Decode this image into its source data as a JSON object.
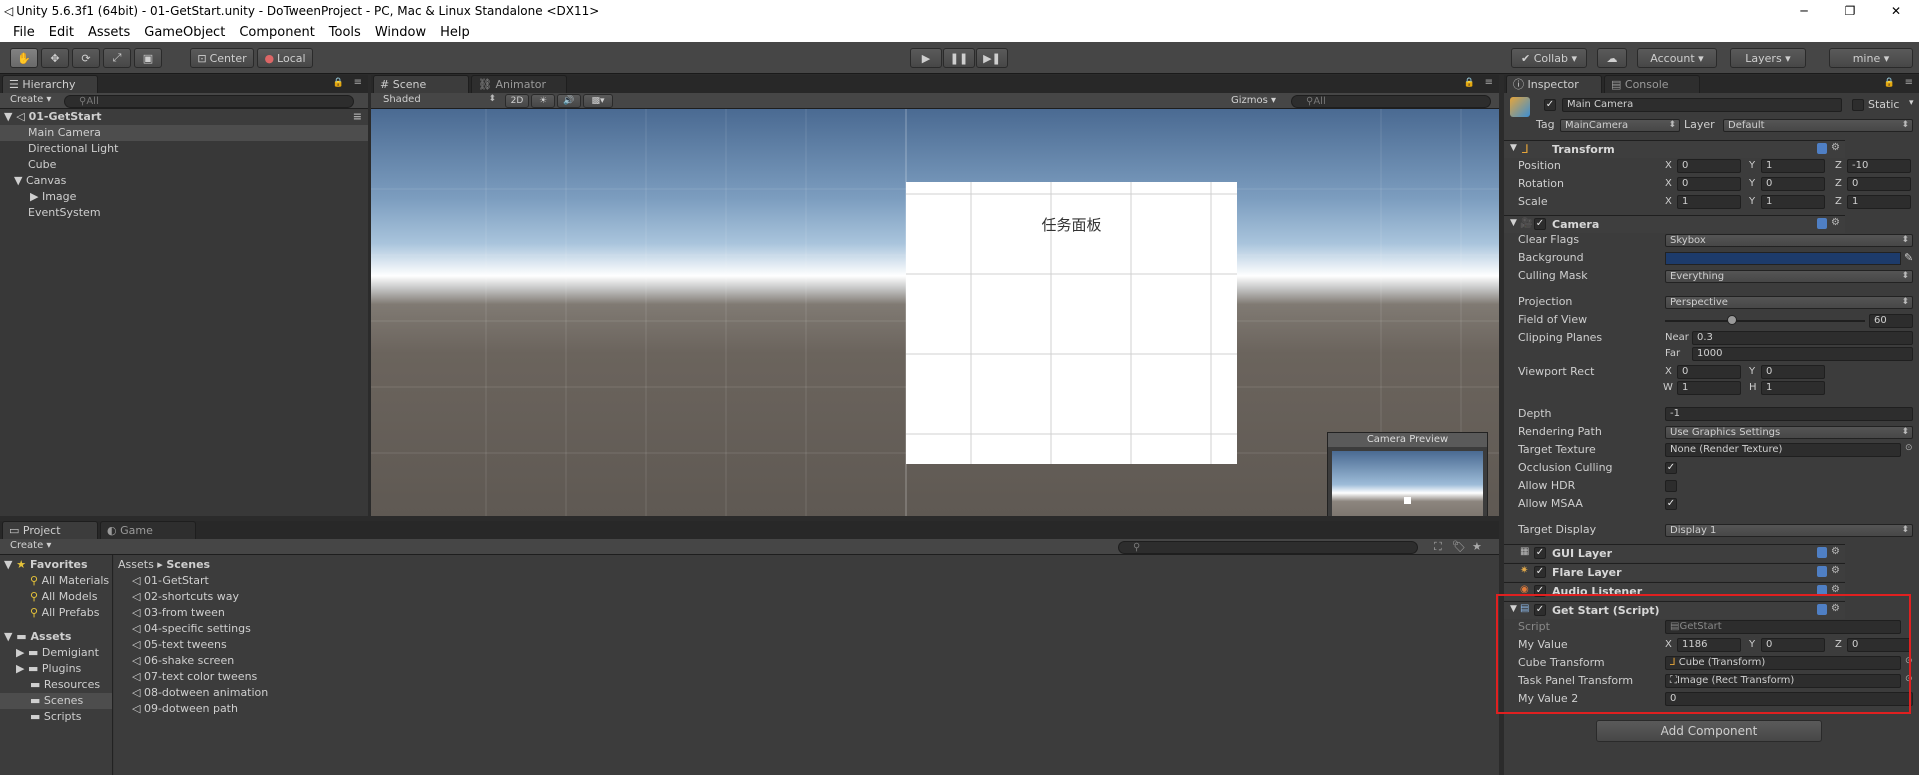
{
  "window": {
    "title": "Unity 5.6.3f1 (64bit) - 01-GetStart.unity - DoTweenProject - PC, Mac & Linux Standalone <DX11>",
    "min": "─",
    "max": "❐",
    "close": "✕"
  },
  "menu": [
    "File",
    "Edit",
    "Assets",
    "GameObject",
    "Component",
    "Tools",
    "Window",
    "Help"
  ],
  "toolbar": {
    "center": "Center",
    "local": "Local",
    "collab": "Collab",
    "account": "Account",
    "layers": "Layers",
    "layout": "mine"
  },
  "hierarchy": {
    "tab": "Hierarchy",
    "create": "Create",
    "search": "All",
    "scene": "01-GetStart",
    "items": [
      "Main Camera",
      "Directional Light",
      "Cube",
      "Canvas",
      "Image",
      "EventSystem"
    ]
  },
  "scene": {
    "tab": "Scene",
    "tab2": "Animator",
    "shading": "Shaded",
    "mode2d": "2D",
    "gizmos": "Gizmos",
    "search": "All",
    "panel_text": "任务面板",
    "preview_title": "Camera Preview"
  },
  "project": {
    "tab": "Project",
    "tab2": "Game",
    "create": "Create",
    "favorites": "Favorites",
    "fav_items": [
      "All Materials",
      "All Models",
      "All Prefabs"
    ],
    "assets": "Assets",
    "asset_folders": [
      "Demigiant",
      "Plugins",
      "Resources",
      "Scenes",
      "Scripts"
    ],
    "breadcrumb": [
      "Assets",
      "Scenes"
    ],
    "files": [
      "01-GetStart",
      "02-shortcuts way",
      "03-from tween",
      "04-specific settings",
      "05-text tweens",
      "06-shake screen",
      "07-text color tweens",
      "08-dotween animation",
      "09-dotween path"
    ]
  },
  "inspector": {
    "tab": "Inspector",
    "tab2": "Console",
    "object_name": "Main Camera",
    "static": "Static",
    "tag_label": "Tag",
    "tag": "MainCamera",
    "layer_label": "Layer",
    "layer": "Default",
    "transform": {
      "title": "Transform",
      "rows": [
        {
          "label": "Position",
          "x": "0",
          "y": "1",
          "z": "-10"
        },
        {
          "label": "Rotation",
          "x": "0",
          "y": "0",
          "z": "0"
        },
        {
          "label": "Scale",
          "x": "1",
          "y": "1",
          "z": "1"
        }
      ]
    },
    "camera": {
      "title": "Camera",
      "clear_flags_label": "Clear Flags",
      "clear_flags": "Skybox",
      "background_label": "Background",
      "background_color": "#1d3b6b",
      "culling_mask_label": "Culling Mask",
      "culling_mask": "Everything",
      "projection_label": "Projection",
      "projection": "Perspective",
      "fov_label": "Field of View",
      "fov": "60",
      "fov_fraction": 0.333,
      "clipping_label": "Clipping Planes",
      "near_label": "Near",
      "near": "0.3",
      "far_label": "Far",
      "far": "1000",
      "viewport_label": "Viewport Rect",
      "vx": "0",
      "vy": "0",
      "vw": "1",
      "vh": "1",
      "depth_label": "Depth",
      "depth": "-1",
      "rendering_path_label": "Rendering Path",
      "rendering_path": "Use Graphics Settings",
      "target_texture_label": "Target Texture",
      "target_texture": "None (Render Texture)",
      "occlusion_label": "Occlusion Culling",
      "occlusion": true,
      "hdr_label": "Allow HDR",
      "hdr": false,
      "msaa_label": "Allow MSAA",
      "msaa": true,
      "target_display_label": "Target Display",
      "target_display": "Display 1"
    },
    "gui_layer": "GUI Layer",
    "flare_layer": "Flare Layer",
    "audio_listener": "Audio Listener",
    "script": {
      "title": "Get Start (Script)",
      "script_label": "Script",
      "script_value": "GetStart",
      "my_value_label": "My Value",
      "x": "1186",
      "y": "0",
      "z": "0",
      "cube_label": "Cube Transform",
      "cube_value": "Cube (Transform)",
      "task_label": "Task Panel Transform",
      "task_value": "Image (Rect Transform)",
      "my_value2_label": "My Value 2",
      "my_value2": "0"
    },
    "add_component": "Add Component"
  }
}
